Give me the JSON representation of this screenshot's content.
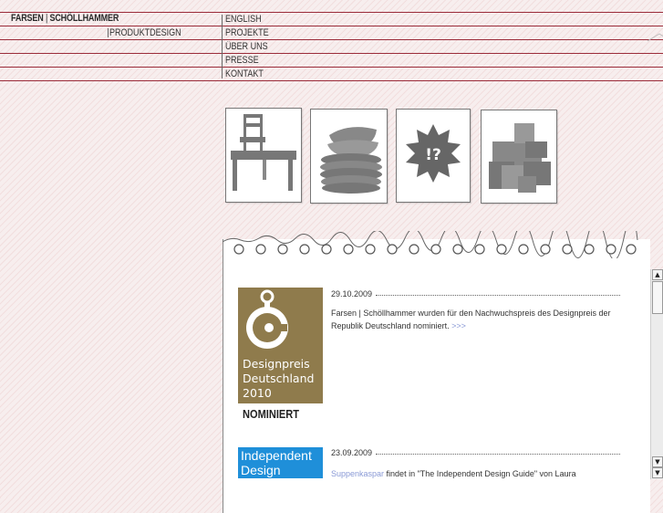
{
  "header": {
    "brand_left": "FARSEN",
    "brand_right": "SCHÖLLHAMMER",
    "subtitle": "PRODUKTDESIGN"
  },
  "nav": {
    "items": [
      {
        "label": "ENGLISH"
      },
      {
        "label": "PROJEKTE"
      },
      {
        "label": "ÜBER UNS"
      },
      {
        "label": "PRESSE"
      },
      {
        "label": "KONTAKT"
      }
    ]
  },
  "categories": [
    {
      "icon": "furniture-icon"
    },
    {
      "icon": "tableware-icon"
    },
    {
      "icon": "concept-icon",
      "glyph": "!?"
    },
    {
      "icon": "boxes-icon"
    }
  ],
  "news": [
    {
      "date": "29.10.2009",
      "text": "Farsen | Schöllhammer wurden für den Nachwuchspreis des Designpreis der Republik Deutschland nominiert.",
      "more": ">>>",
      "logo": {
        "line1": "Designpreis",
        "line2": "Deutschland",
        "line3": "2010",
        "caption": "NOMINIERT"
      }
    },
    {
      "date": "23.09.2009",
      "link_text": "Suppenkaspar",
      "text": " findet in \"The Independent Design Guide\" von Laura",
      "logo": {
        "line1": "Independent",
        "line2": "Design"
      }
    }
  ],
  "colors": {
    "accent_line": "#9b2c3a",
    "designpreis_brown": "#8f7b4c",
    "independent_blue": "#1f8fd9",
    "link": "#8a9ad6"
  }
}
